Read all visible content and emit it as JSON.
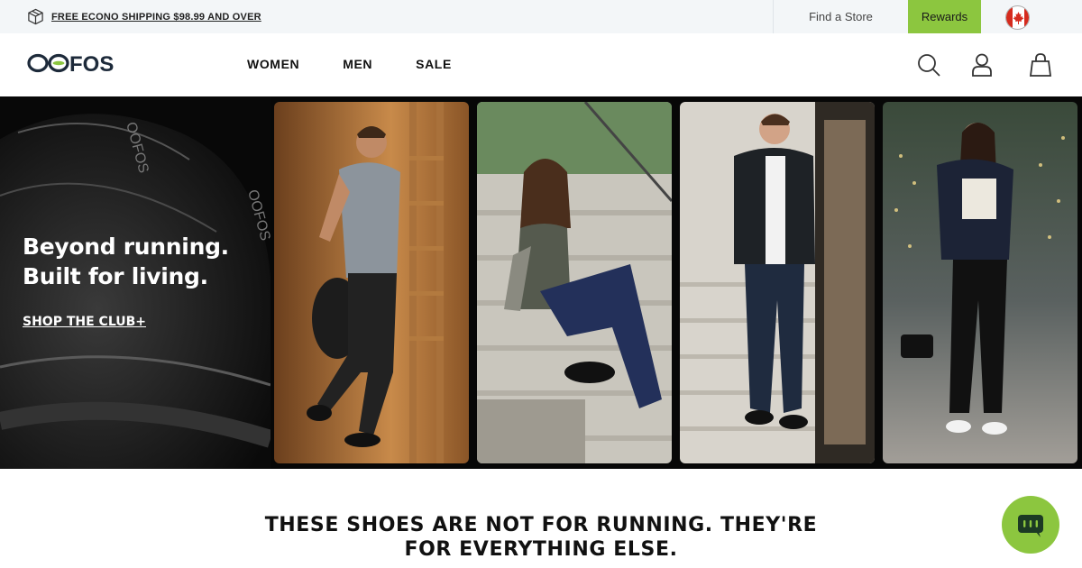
{
  "topbar": {
    "shipping_text": "FREE ECONO SHIPPING $98.99 AND OVER",
    "find_store": "Find a Store",
    "rewards": "Rewards",
    "country_flag": "canada-flag-icon",
    "brand_green": "#8cc63f",
    "bg": "#f3f6f8"
  },
  "header": {
    "logo_text": "OOFOS",
    "nav": [
      "WOMEN",
      "MEN",
      "SALE"
    ],
    "icons": [
      "search-icon",
      "account-icon",
      "cart-icon"
    ]
  },
  "hero": {
    "headline_line1": "Beyond running.",
    "headline_line2": "Built for living.",
    "cta": "SHOP THE CLUB+",
    "panels": [
      "man-walking-with-gym-bag",
      "woman-sitting-on-steps",
      "man-in-bomber-jacket-on-stairs",
      "woman-with-handbag-at-night"
    ]
  },
  "section": {
    "tagline_line1": "THESE SHOES ARE NOT FOR RUNNING. THEY'RE",
    "tagline_line2": "FOR EVERYTHING ELSE."
  },
  "chat": {
    "icon": "chat-icon"
  }
}
